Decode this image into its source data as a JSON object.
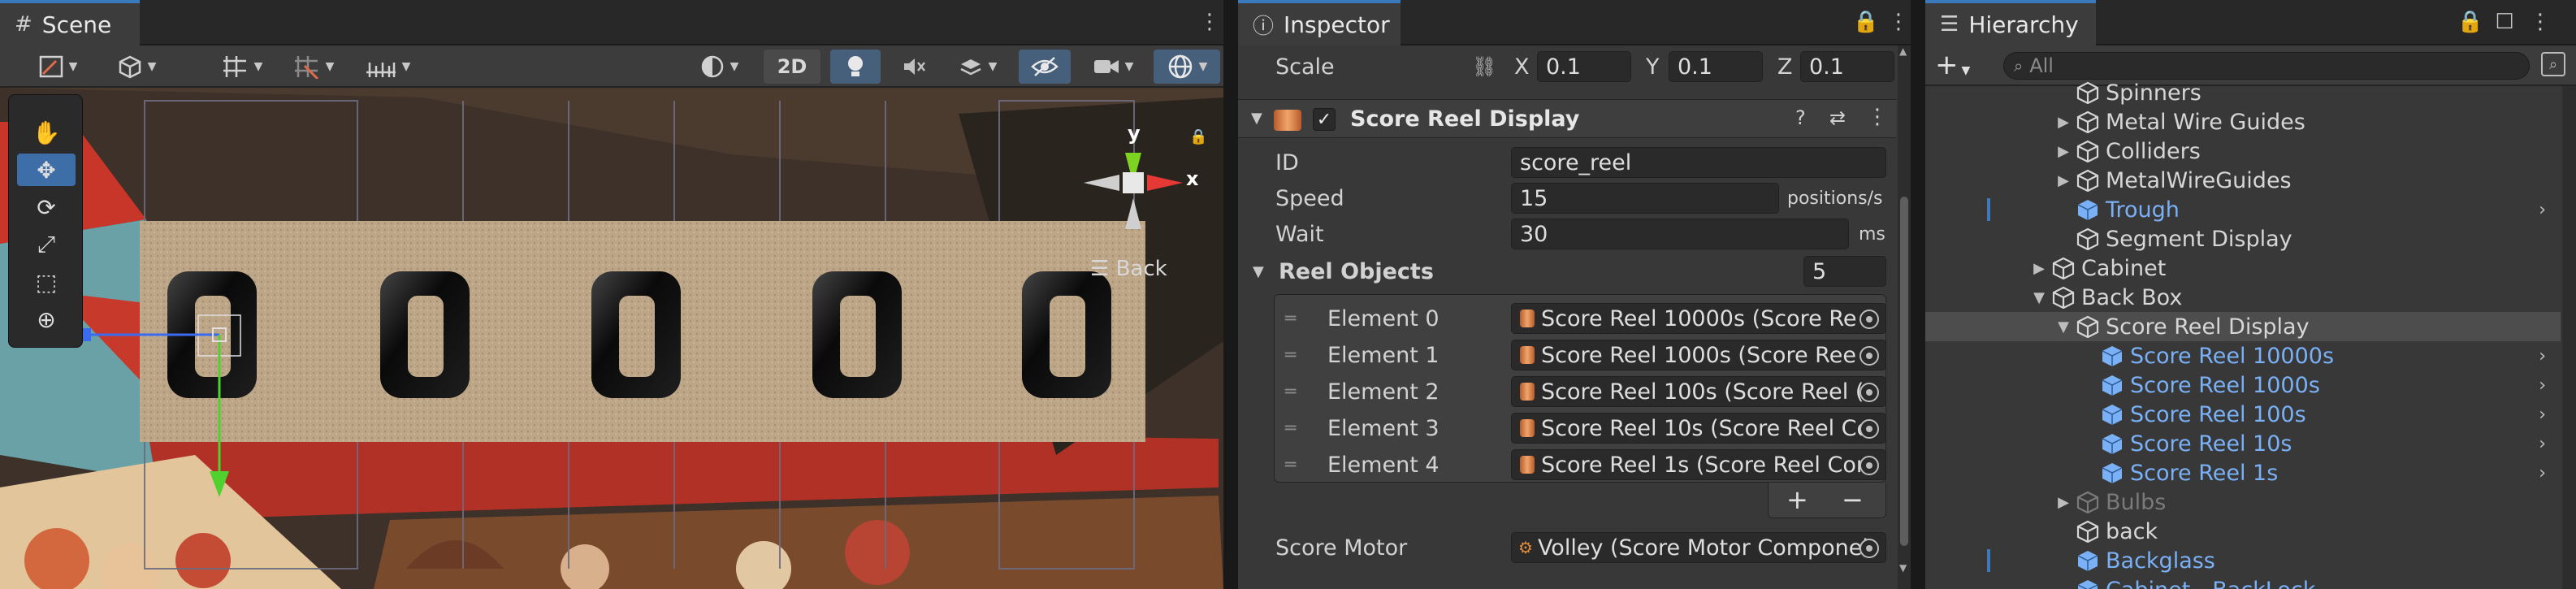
{
  "scene": {
    "tab": "Scene",
    "toolbar": {
      "mode_2d": "2D"
    },
    "gizmo": {
      "y": "y",
      "x": "x",
      "view": "Back"
    }
  },
  "inspector": {
    "tab": "Inspector",
    "scale": {
      "label": "Scale",
      "x_label": "X",
      "x": "0.1",
      "y_label": "Y",
      "y": "0.1",
      "z_label": "Z",
      "z": "0.1"
    },
    "component": "Score Reel Display",
    "id": {
      "label": "ID",
      "value": "score_reel"
    },
    "speed": {
      "label": "Speed",
      "value": "15",
      "unit": "positions/s"
    },
    "wait": {
      "label": "Wait",
      "value": "30",
      "unit": "ms"
    },
    "reel_objects": {
      "label": "Reel Objects",
      "count": "5",
      "elements": [
        {
          "label": "Element 0",
          "value": "Score Reel 10000s (Score Re"
        },
        {
          "label": "Element 1",
          "value": "Score Reel 1000s (Score Ree"
        },
        {
          "label": "Element 2",
          "value": "Score Reel 100s (Score Reel ("
        },
        {
          "label": "Element 3",
          "value": "Score Reel 10s (Score Reel Co"
        },
        {
          "label": "Element 4",
          "value": "Score Reel 1s (Score Reel Cor"
        }
      ],
      "add": "+",
      "remove": "−"
    },
    "score_motor": {
      "label": "Score Motor",
      "value": "Volley (Score Motor Componei"
    }
  },
  "hierarchy": {
    "tab": "Hierarchy",
    "search_placeholder": "All",
    "add": "+",
    "items": [
      {
        "label": "Spinners"
      },
      {
        "label": "Metal Wire Guides"
      },
      {
        "label": "Colliders"
      },
      {
        "label": "MetalWireGuides"
      },
      {
        "label": "Trough"
      },
      {
        "label": "Segment Display"
      },
      {
        "label": "Cabinet"
      },
      {
        "label": "Back Box"
      },
      {
        "label": "Score Reel Display"
      },
      {
        "label": "Score Reel 10000s"
      },
      {
        "label": "Score Reel 1000s"
      },
      {
        "label": "Score Reel 100s"
      },
      {
        "label": "Score Reel 10s"
      },
      {
        "label": "Score Reel 1s"
      },
      {
        "label": "Bulbs"
      },
      {
        "label": "back"
      },
      {
        "label": "Backglass"
      },
      {
        "label": "Cabinet - BackLock"
      }
    ]
  },
  "colors": {
    "accent": "#3a79bb",
    "selection": "#46607c",
    "prefab_blue": "#7ab0f5"
  }
}
